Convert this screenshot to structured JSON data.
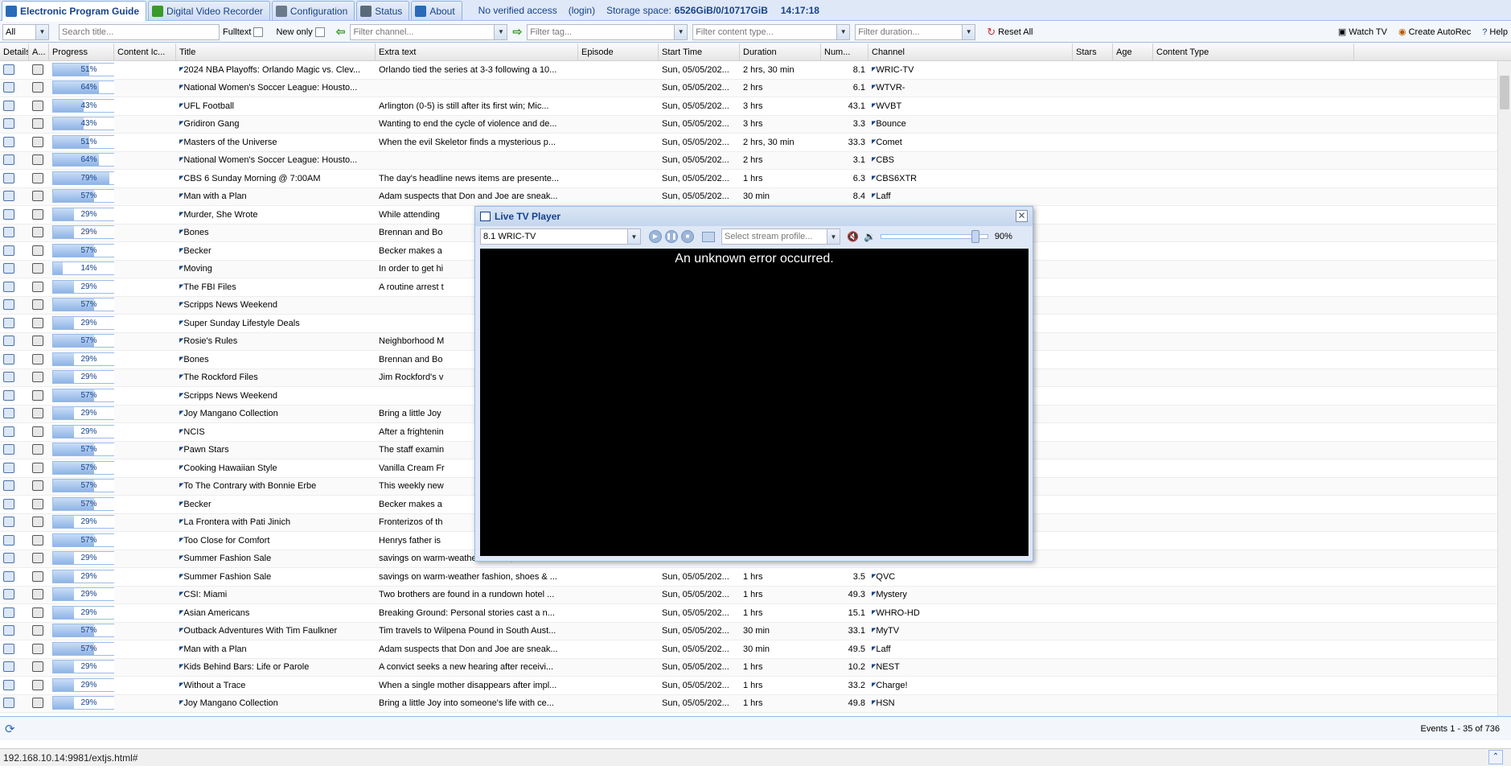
{
  "tabs": [
    {
      "label": "Electronic Program Guide",
      "active": true,
      "icon": "epg-icon"
    },
    {
      "label": "Digital Video Recorder",
      "active": false,
      "icon": "dvr-download-icon"
    },
    {
      "label": "Configuration",
      "active": false,
      "icon": "wrench-icon"
    },
    {
      "label": "Status",
      "active": false,
      "icon": "eye-icon"
    },
    {
      "label": "About",
      "active": false,
      "icon": "info-icon"
    }
  ],
  "status": {
    "access": "No verified access",
    "login": "(login)",
    "storage_label": "Storage space:",
    "storage_value": "6526GiB/0/10717GiB",
    "time": "14:17:18"
  },
  "toolbar": {
    "mode": "All",
    "search_placeholder": "Search title...",
    "fulltext_label": "Fulltext",
    "new_only_label": "New only",
    "channel_placeholder": "Filter channel...",
    "tag_placeholder": "Filter tag...",
    "content_type_placeholder": "Filter content type...",
    "duration_placeholder": "Filter duration...",
    "reset_label": "Reset All",
    "watch_label": "Watch TV",
    "autorec_label": "Create AutoRec",
    "help_label": "Help"
  },
  "columns": [
    "Details",
    "A...",
    "Progress",
    "Content Ic...",
    "Title",
    "Extra text",
    "Episode",
    "Start Time",
    "Duration",
    "Num...",
    "Channel",
    "Stars",
    "Age",
    "Content Type"
  ],
  "rows": [
    {
      "progress": 51,
      "title": "2024 NBA Playoffs: Orlando Magic vs. Clev...",
      "extra": "Orlando tied the series at 3-3 following a 10...",
      "start": "Sun, 05/05/202...",
      "duration": "2 hrs, 30 min",
      "num": "8.1",
      "channel": "WRIC-TV"
    },
    {
      "progress": 64,
      "title": "National Women's Soccer League: Housto...",
      "extra": "",
      "start": "Sun, 05/05/202...",
      "duration": "2 hrs",
      "num": "6.1",
      "channel": "WTVR-"
    },
    {
      "progress": 43,
      "title": "UFL Football",
      "extra": "Arlington (0-5) is still after its first win; Mic...",
      "start": "Sun, 05/05/202...",
      "duration": "3 hrs",
      "num": "43.1",
      "channel": "WVBT"
    },
    {
      "progress": 43,
      "title": "Gridiron Gang",
      "extra": "Wanting to end the cycle of violence and de...",
      "start": "Sun, 05/05/202...",
      "duration": "3 hrs",
      "num": "3.3",
      "channel": "Bounce"
    },
    {
      "progress": 51,
      "title": "Masters of the Universe",
      "extra": "When the evil Skeletor finds a mysterious p...",
      "start": "Sun, 05/05/202...",
      "duration": "2 hrs, 30 min",
      "num": "33.3",
      "channel": "Comet"
    },
    {
      "progress": 64,
      "title": "National Women's Soccer League: Housto...",
      "extra": "",
      "start": "Sun, 05/05/202...",
      "duration": "2 hrs",
      "num": "3.1",
      "channel": "CBS"
    },
    {
      "progress": 79,
      "title": "CBS 6 Sunday Morning @ 7:00AM",
      "extra": "The day's headline news items are presente...",
      "start": "Sun, 05/05/202...",
      "duration": "1 hrs",
      "num": "6.3",
      "channel": "CBS6XTR"
    },
    {
      "progress": 57,
      "title": "Man with a Plan",
      "extra": "Adam suspects that Don and Joe are sneak...",
      "start": "Sun, 05/05/202...",
      "duration": "30 min",
      "num": "8.4",
      "channel": "Laff"
    },
    {
      "progress": 29,
      "title": "Murder, She Wrote",
      "extra": "While attending",
      "start": "",
      "duration": "",
      "num": "",
      "channel": ""
    },
    {
      "progress": 29,
      "title": "Bones",
      "extra": "Brennan and Bo",
      "start": "",
      "duration": "",
      "num": "",
      "channel": ""
    },
    {
      "progress": 57,
      "title": "Becker",
      "extra": "Becker makes a",
      "start": "",
      "duration": "",
      "num": "",
      "channel": ""
    },
    {
      "progress": 14,
      "title": "Moving",
      "extra": "In order to get hi",
      "start": "",
      "duration": "",
      "num": "",
      "channel": ""
    },
    {
      "progress": 29,
      "title": "The FBI Files",
      "extra": "A routine arrest t",
      "start": "",
      "duration": "",
      "num": "",
      "channel": ""
    },
    {
      "progress": 57,
      "title": "Scripps News Weekend",
      "extra": "",
      "start": "",
      "duration": "",
      "num": "",
      "channel": ""
    },
    {
      "progress": 29,
      "title": "Super Sunday Lifestyle Deals",
      "extra": "",
      "start": "",
      "duration": "",
      "num": "",
      "channel": ""
    },
    {
      "progress": 57,
      "title": "Rosie's Rules",
      "extra": "Neighborhood M",
      "start": "",
      "duration": "",
      "num": "",
      "channel": ""
    },
    {
      "progress": 29,
      "title": "Bones",
      "extra": "Brennan and Bo",
      "start": "",
      "duration": "",
      "num": "",
      "channel": ""
    },
    {
      "progress": 29,
      "title": "The Rockford Files",
      "extra": "Jim Rockford's v",
      "start": "",
      "duration": "",
      "num": "",
      "channel": ""
    },
    {
      "progress": 57,
      "title": "Scripps News Weekend",
      "extra": "",
      "start": "",
      "duration": "",
      "num": "",
      "channel": ""
    },
    {
      "progress": 29,
      "title": "Joy Mangano Collection",
      "extra": "Bring a little Joy",
      "start": "",
      "duration": "",
      "num": "",
      "channel": ""
    },
    {
      "progress": 29,
      "title": "NCIS",
      "extra": "After a frightenin",
      "start": "",
      "duration": "",
      "num": "",
      "channel": ""
    },
    {
      "progress": 57,
      "title": "Pawn Stars",
      "extra": "The staff examin",
      "start": "",
      "duration": "",
      "num": "",
      "channel": ""
    },
    {
      "progress": 57,
      "title": "Cooking Hawaiian Style",
      "extra": "Vanilla Cream Fr",
      "start": "",
      "duration": "",
      "num": "",
      "channel": ""
    },
    {
      "progress": 57,
      "title": "To The Contrary with Bonnie Erbe",
      "extra": "This weekly new",
      "start": "",
      "duration": "",
      "num": "",
      "channel": ""
    },
    {
      "progress": 57,
      "title": "Becker",
      "extra": "Becker makes a",
      "start": "",
      "duration": "",
      "num": "",
      "channel": ""
    },
    {
      "progress": 29,
      "title": "La Frontera with Pati Jinich",
      "extra": "Fronterizos of th",
      "start": "",
      "duration": "",
      "num": "",
      "channel": ""
    },
    {
      "progress": 57,
      "title": "Too Close for Comfort",
      "extra": "Henrys father is",
      "start": "",
      "duration": "",
      "num": "",
      "channel": ""
    },
    {
      "progress": 29,
      "title": "Summer Fashion Sale",
      "extra": "savings on warm-weather fashion, shoes & ...",
      "start": "",
      "duration": "",
      "num": "",
      "channel": ""
    },
    {
      "progress": 29,
      "title": "Summer Fashion Sale",
      "extra": "savings on warm-weather fashion, shoes & ...",
      "start": "Sun, 05/05/202...",
      "duration": "1 hrs",
      "num": "3.5",
      "channel": "QVC"
    },
    {
      "progress": 29,
      "title": "CSI: Miami",
      "extra": "Two brothers are found in a rundown hotel ...",
      "start": "Sun, 05/05/202...",
      "duration": "1 hrs",
      "num": "49.3",
      "channel": "Mystery"
    },
    {
      "progress": 29,
      "title": "Asian Americans",
      "extra": "Breaking Ground: Personal stories cast a n...",
      "start": "Sun, 05/05/202...",
      "duration": "1 hrs",
      "num": "15.1",
      "channel": "WHRO-HD"
    },
    {
      "progress": 57,
      "title": "Outback Adventures With Tim Faulkner",
      "extra": "Tim travels to Wilpena Pound in South Aust...",
      "start": "Sun, 05/05/202...",
      "duration": "30 min",
      "num": "33.1",
      "channel": "MyTV"
    },
    {
      "progress": 57,
      "title": "Man with a Plan",
      "extra": "Adam suspects that Don and Joe are sneak...",
      "start": "Sun, 05/05/202...",
      "duration": "30 min",
      "num": "49.5",
      "channel": "Laff"
    },
    {
      "progress": 29,
      "title": "Kids Behind Bars: Life or Parole",
      "extra": "A convict seeks a new hearing after receivi...",
      "start": "Sun, 05/05/202...",
      "duration": "1 hrs",
      "num": "10.2",
      "channel": "NEST"
    },
    {
      "progress": 29,
      "title": "Without a Trace",
      "extra": "When a single mother disappears after impl...",
      "start": "Sun, 05/05/202...",
      "duration": "1 hrs",
      "num": "33.2",
      "channel": "Charge!"
    },
    {
      "progress": 29,
      "title": "Joy Mangano Collection",
      "extra": "Bring a little Joy into someone's life with ce...",
      "start": "Sun, 05/05/202...",
      "duration": "1 hrs",
      "num": "49.8",
      "channel": "HSN"
    }
  ],
  "paging": {
    "summary": "Events 1 - 35 of 736"
  },
  "url": "192.168.10.14:9981/extjs.html#",
  "player": {
    "title": "Live TV Player",
    "channel": "8.1 WRIC-TV",
    "profile_placeholder": "Select stream profile...",
    "volume": "90%",
    "volume_level": 0.9,
    "error": "An unknown error occurred."
  },
  "colors": {
    "accent": "#15428b",
    "header_bg": "#dfe8f6",
    "border": "#99bbe8"
  }
}
